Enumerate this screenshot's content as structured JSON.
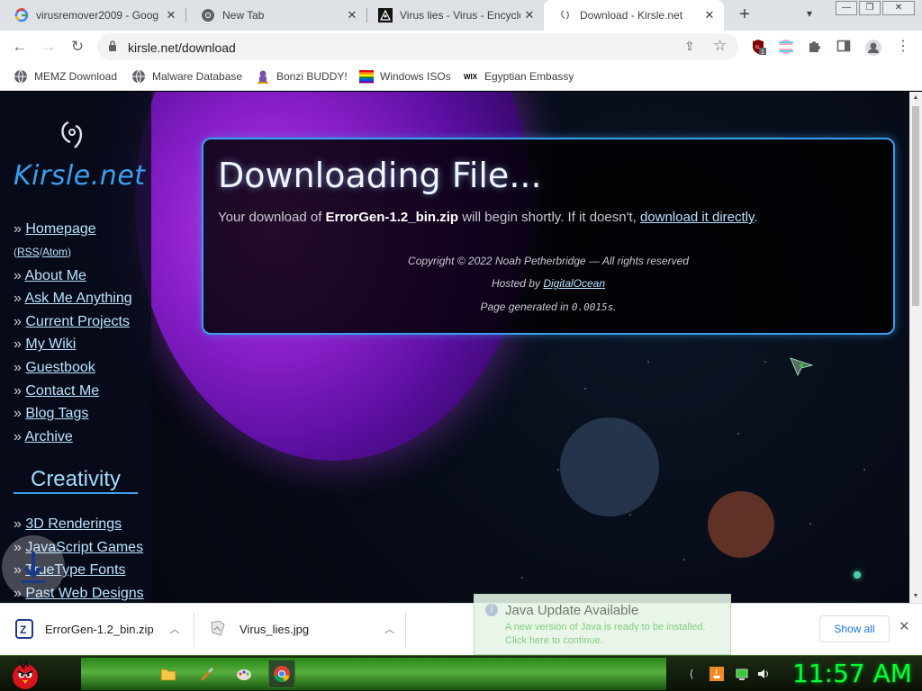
{
  "browser": {
    "tabs": [
      {
        "title": "virusremover2009 - Goog",
        "favicon": "google-g-icon",
        "active": false
      },
      {
        "title": "New Tab",
        "favicon": "chrome-icon",
        "active": false
      },
      {
        "title": "Virus lies - Virus - Encyclo",
        "favicon": "virus-site-icon",
        "active": false
      },
      {
        "title": "Download - Kirsle.net",
        "favicon": "kirsle-icon",
        "active": true
      }
    ],
    "new_tab_label": "+",
    "window_controls": [
      "minimize",
      "restore",
      "close"
    ],
    "url": "kirsle.net/download",
    "extension_badge": "1",
    "bookmarks": [
      {
        "label": "MEMZ Download",
        "icon": "globe-icon"
      },
      {
        "label": "Malware Database",
        "icon": "globe-icon"
      },
      {
        "label": "Bonzi BUDDY!",
        "icon": "bonzi-icon"
      },
      {
        "label": "Windows ISOs",
        "icon": "windows-flag-icon"
      },
      {
        "label": "Egyptian Embassy",
        "icon": "wix-icon"
      }
    ]
  },
  "site": {
    "logo_text": "Kirsle.net",
    "nav": [
      {
        "label": "Homepage"
      },
      {
        "label_rss": "RSS",
        "label_atom": "Atom"
      },
      {
        "label": "About Me"
      },
      {
        "label": "Ask Me Anything"
      },
      {
        "label": "Current Projects"
      },
      {
        "label": "My Wiki"
      },
      {
        "label": "Guestbook"
      },
      {
        "label": "Contact Me"
      },
      {
        "label": "Blog Tags"
      },
      {
        "label": "Archive"
      }
    ],
    "section_creativity": "Creativity",
    "nav_creativity": [
      {
        "label": "3D Renderings"
      },
      {
        "label": "JavaScript Games"
      },
      {
        "label": "TrueType Fonts"
      },
      {
        "label": "Past Web Designs"
      }
    ],
    "bullet": "»",
    "slash": "/",
    "paren_open": "(",
    "paren_close": ")"
  },
  "panel": {
    "heading": "Downloading File...",
    "msg_prefix": "Your download of ",
    "filename": "ErrorGen-1.2_bin.zip",
    "msg_middle": " will begin shortly. If it doesn't, ",
    "direct_link": "download it directly",
    "msg_suffix": ".",
    "copyright": "Copyright © 2022 Noah Petherbridge — All rights reserved",
    "hosted_prefix": "Hosted by ",
    "hosted_link": "DigitalOcean",
    "generated_prefix": "Page generated in ",
    "generated_value": "0.0015s",
    "generated_suffix": "."
  },
  "downloads": {
    "items": [
      {
        "filename": "ErrorGen-1.2_bin.zip",
        "icon": "zip-file-icon"
      },
      {
        "filename": "Virus_lies.jpg",
        "icon": "image-file-icon"
      }
    ],
    "show_all": "Show all"
  },
  "java_popup": {
    "title": "Java Update Available",
    "line1": "A new version of Java is ready to be installed.",
    "line2": "Click here to continue."
  },
  "taskbar": {
    "clock": "11:57 AM"
  }
}
